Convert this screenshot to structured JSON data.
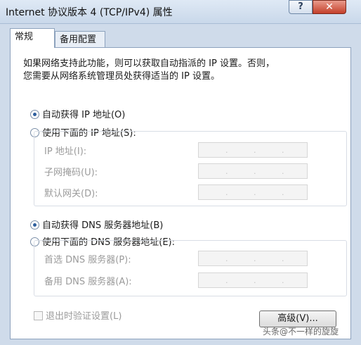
{
  "window": {
    "title": "Internet 协议版本 4 (TCP/IPv4) 属性",
    "help_label": "?",
    "close_label": "✕"
  },
  "tabs": [
    {
      "label": "常规",
      "active": true
    },
    {
      "label": "备用配置",
      "active": false
    }
  ],
  "description": {
    "line1": "如果网络支持此功能，则可以获取自动指派的 IP 设置。否则，",
    "line2": "您需要从网络系统管理员处获得适当的 IP 设置。"
  },
  "ip_section": {
    "auto_label": "自动获得 IP 地址(O)",
    "manual_label": "使用下面的 IP 地址(S):",
    "selected": "auto",
    "fields": [
      {
        "label": "IP 地址(I):",
        "value": ". . ."
      },
      {
        "label": "子网掩码(U):",
        "value": ". . ."
      },
      {
        "label": "默认网关(D):",
        "value": ". . ."
      }
    ]
  },
  "dns_section": {
    "auto_label": "自动获得 DNS 服务器地址(B)",
    "manual_label": "使用下面的 DNS 服务器地址(E):",
    "selected": "auto",
    "fields": [
      {
        "label": "首选 DNS 服务器(P):",
        "value": ". . ."
      },
      {
        "label": "备用 DNS 服务器(A):",
        "value": ". . ."
      }
    ]
  },
  "validate_checkbox": {
    "label": "退出时验证设置(L)",
    "checked": false
  },
  "advanced_button": {
    "label": "高级(V)..."
  },
  "watermark": "头条@不一样的旋旋"
}
